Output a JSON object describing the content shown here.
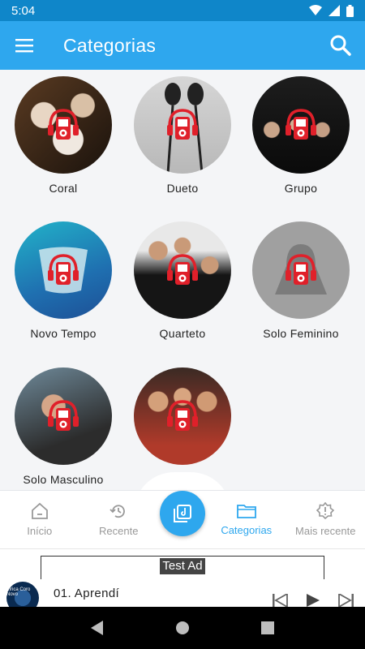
{
  "status": {
    "time": "5:04"
  },
  "appbar": {
    "title": "Categorias"
  },
  "categories": [
    {
      "label": "Coral"
    },
    {
      "label": "Dueto"
    },
    {
      "label": "Grupo"
    },
    {
      "label": "Novo Tempo"
    },
    {
      "label": "Quarteto"
    },
    {
      "label": "Solo Feminino"
    },
    {
      "label": "Solo Masculino"
    },
    {
      "label": ""
    }
  ],
  "nav": {
    "items": [
      {
        "label": "Início",
        "icon": "home-icon"
      },
      {
        "label": "Recente",
        "icon": "history-icon"
      },
      {
        "label": "Categorias",
        "icon": "folder-icon"
      },
      {
        "label": "Mais recente",
        "icon": "new-badge-icon"
      }
    ],
    "active_color": "#2ea7ee"
  },
  "ad": {
    "label": "Test Ad"
  },
  "player": {
    "track": "01. Aprendí",
    "cover_text": "Lírica Coro Novo"
  },
  "colors": {
    "accent": "#2ea7ee",
    "status": "#0f86c9"
  }
}
